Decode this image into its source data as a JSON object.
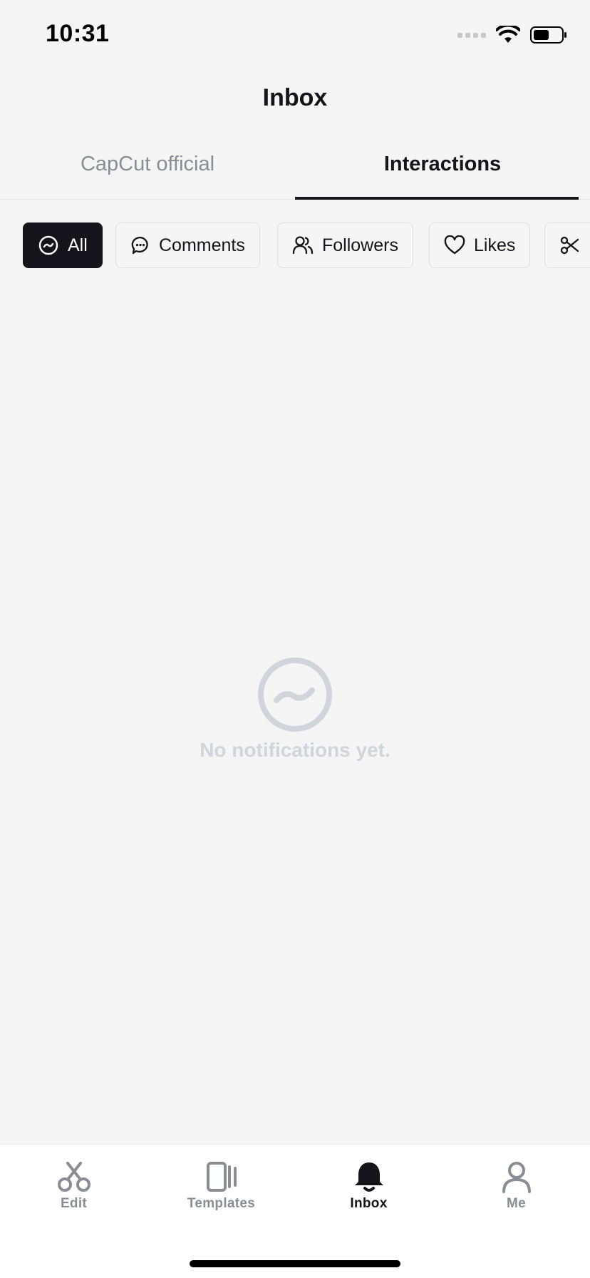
{
  "status_bar": {
    "time": "10:31"
  },
  "header": {
    "title": "Inbox"
  },
  "tabs": [
    {
      "label": "CapCut official"
    },
    {
      "label": "Interactions"
    }
  ],
  "filters": [
    {
      "label": "All",
      "icon": "activity-circle-icon"
    },
    {
      "label": "Comments",
      "icon": "comment-bubble-icon"
    },
    {
      "label": "Followers",
      "icon": "followers-icon"
    },
    {
      "label": "Likes",
      "icon": "heart-icon"
    },
    {
      "label": "",
      "icon": "scissors-icon"
    }
  ],
  "empty_state": {
    "message": "No notifications yet."
  },
  "bottom_nav": [
    {
      "label": "Edit",
      "icon": "scissors-icon"
    },
    {
      "label": "Templates",
      "icon": "templates-icon"
    },
    {
      "label": "Inbox",
      "icon": "bell-icon"
    },
    {
      "label": "Me",
      "icon": "person-icon"
    }
  ],
  "colors": {
    "background": "#f5f5f5",
    "primary": "#14141a",
    "muted": "#8a8d94",
    "empty": "#cfd5da"
  }
}
